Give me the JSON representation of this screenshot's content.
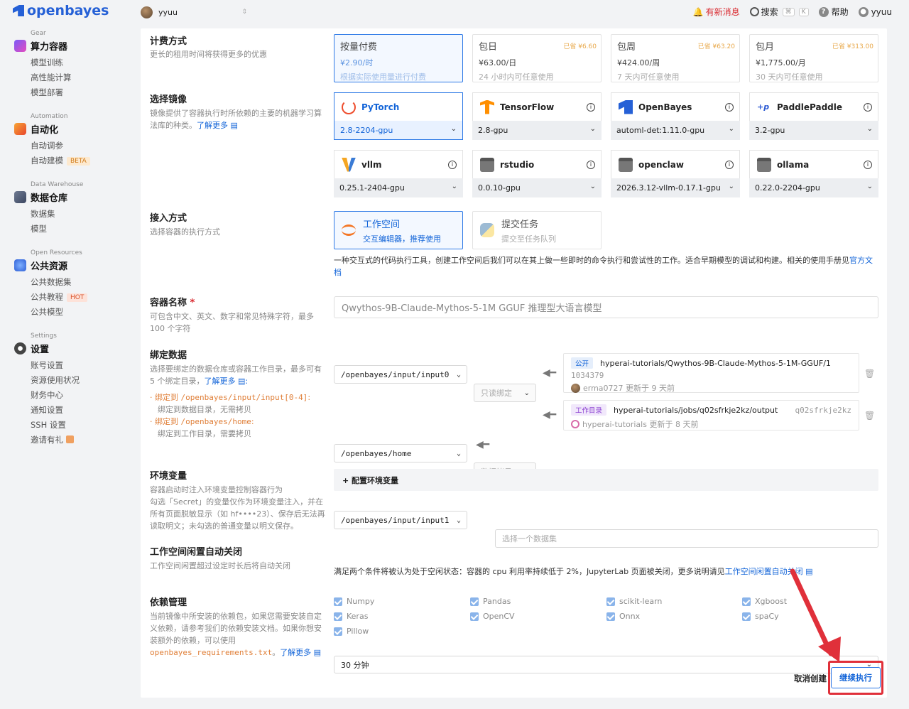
{
  "topbar": {
    "brand": "openbayes",
    "user": "yyuu",
    "new_messages": "有新消息",
    "search": "搜索",
    "search_key1": "⌘",
    "search_key2": "K",
    "help": "帮助",
    "account": "yyuu"
  },
  "sidebar": {
    "gear": {
      "caption": "Gear",
      "title": "算力容器",
      "items": [
        "模型训练",
        "高性能计算",
        "模型部署"
      ]
    },
    "automation": {
      "caption": "Automation",
      "title": "自动化",
      "items": [
        "自动调参",
        "自动建模"
      ],
      "badge": "BETA"
    },
    "warehouse": {
      "caption": "Data Warehouse",
      "title": "数据仓库",
      "items": [
        "数据集",
        "模型"
      ]
    },
    "open": {
      "caption": "Open Resources",
      "title": "公共资源",
      "items": [
        "公共数据集",
        "公共教程",
        "公共模型"
      ],
      "badge": "HOT"
    },
    "settings": {
      "caption": "Settings",
      "title": "设置",
      "items": [
        "账号设置",
        "资源使用状况",
        "财务中心",
        "通知设置",
        "SSH 设置",
        "邀请有礼"
      ]
    }
  },
  "billing": {
    "label": "计费方式",
    "desc": "更长的租用时间将获得更多的优惠",
    "options": [
      {
        "title": "按量付费",
        "price": "¥2.90/时",
        "desc": "根据实际使用量进行付费",
        "save": ""
      },
      {
        "title": "包日",
        "price": "¥63.00/日",
        "desc": "24 小时内可任意使用",
        "save": "已省 ¥6.60"
      },
      {
        "title": "包周",
        "price": "¥424.00/周",
        "desc": "7 天内可任意使用",
        "save": "已省 ¥63.20"
      },
      {
        "title": "包月",
        "price": "¥1,775.00/月",
        "desc": "30 天内可任意使用",
        "save": "已省 ¥313.00"
      }
    ]
  },
  "image": {
    "label": "选择镜像",
    "desc": "镜像提供了容器执行时所依赖的主要的机器学习算法库的种类。",
    "learn_more": "了解更多",
    "options": [
      {
        "name": "PyTorch",
        "version": "2.8-2204-gpu"
      },
      {
        "name": "TensorFlow",
        "version": "2.8-gpu"
      },
      {
        "name": "OpenBayes",
        "version": "automl-det:1.11.0-gpu"
      },
      {
        "name": "PaddlePaddle",
        "version": "3.2-gpu"
      },
      {
        "name": "vllm",
        "version": "0.25.1-2404-gpu"
      },
      {
        "name": "rstudio",
        "version": "0.0.10-gpu"
      },
      {
        "name": "openclaw",
        "version": "2026.3.12-vllm-0.17.1-gpu"
      },
      {
        "name": "ollama",
        "version": "0.22.0-2204-gpu"
      }
    ],
    "colors": {
      "pytorch": "#ee4c2c",
      "tensorflow": "#ff8f00",
      "openbayes": "#2560d6",
      "vllm_a": "#f5a623",
      "vllm_b": "#3a7bd5"
    }
  },
  "access": {
    "label": "接入方式",
    "desc": "选择容器的执行方式",
    "options": [
      {
        "title": "工作空间",
        "sub": "交互编辑器，推荐使用"
      },
      {
        "title": "提交任务",
        "sub": "提交至任务队列"
      }
    ],
    "note": "一种交互式的代码执行工具，创建工作空间后我们可以在其上做一些即时的命令执行和尝试性的工作。适合早期模型的调试和构建。相关的使用手册见",
    "note_link": "官方文档"
  },
  "container_name": {
    "label": "容器名称",
    "required": "*",
    "desc": "可包含中文、英文、数字和常见特殊字符，最多 100 个字符",
    "value": "Qwythos-9B-Claude-Mythos-5-1M GGUF 推理型大语言模型"
  },
  "binding": {
    "label": "绑定数据",
    "desc": "选择要绑定的数据仓库或容器工作目录，最多可有 5 个绑定目录，",
    "learn_more": "了解更多",
    "hint1_pre": "绑定到",
    "hint1_path": "/openbayes/input/input[0-4]",
    "hint1_desc": "绑定到数据目录，无需拷贝",
    "hint2_pre": "绑定到",
    "hint2_path": "/openbayes/home",
    "hint2_desc": "绑定到工作目录，需要拷贝",
    "rows": [
      {
        "path": "/openbayes/input/input0",
        "mode": "只读绑定",
        "tag": "公开",
        "src": "hyperai-tutorials/Qwythos-9B-Claude-Mythos-5-1M-GGUF/1",
        "id": "1034379",
        "meta": "erma0727 更新于 9 天前"
      },
      {
        "path": "/openbayes/home",
        "mode": "数据拷贝",
        "tag": "工作目录",
        "src": "hyperai-tutorials/jobs/q02sfrkje2kz/output",
        "id": "q02sfrkje2kz",
        "meta": "hyperai-tutorials 更新于 8 天前"
      },
      {
        "path": "/openbayes/input/input1",
        "placeholder": "选择一个数据集"
      }
    ]
  },
  "env": {
    "label": "环境变量",
    "desc": "容器启动时注入环境变量控制容器行为\n勾选「Secret」的变量仅作为环境变量注入，并在所有页面脱敏显示（如 hf••••23）、保存后无法再读取明文；未勾选的普通变量以明文保存。",
    "button": "+ 配置环境变量"
  },
  "idle": {
    "label": "工作空间闲置自动关闭",
    "desc": "工作空间闲置超过设定时长后将自动关闭",
    "value": "30 分钟",
    "note": "满足两个条件将被认为处于空闲状态：容器的 cpu 利用率持续低于 2%，JupyterLab 页面被关闭，更多说明请见",
    "note_link": "工作空间闲置自动关闭"
  },
  "deps": {
    "label": "依赖管理",
    "desc": "当前镜像中所安装的依赖包，如果您需要安装自定义依赖，请参考我们的依赖安装文档。如果你想安装额外的依赖，可以使用",
    "file": "openbayes_requirements.txt",
    "learn_more": "了解更多",
    "packages": [
      "Numpy",
      "Pandas",
      "scikit-learn",
      "Xgboost",
      "Keras",
      "OpenCV",
      "Onnx",
      "spaCy",
      "Pillow"
    ]
  },
  "actions": {
    "cancel": "取消创建",
    "continue": "继续执行"
  },
  "colors": {
    "accent": "#1264d8",
    "annotation": "#e0303a"
  }
}
